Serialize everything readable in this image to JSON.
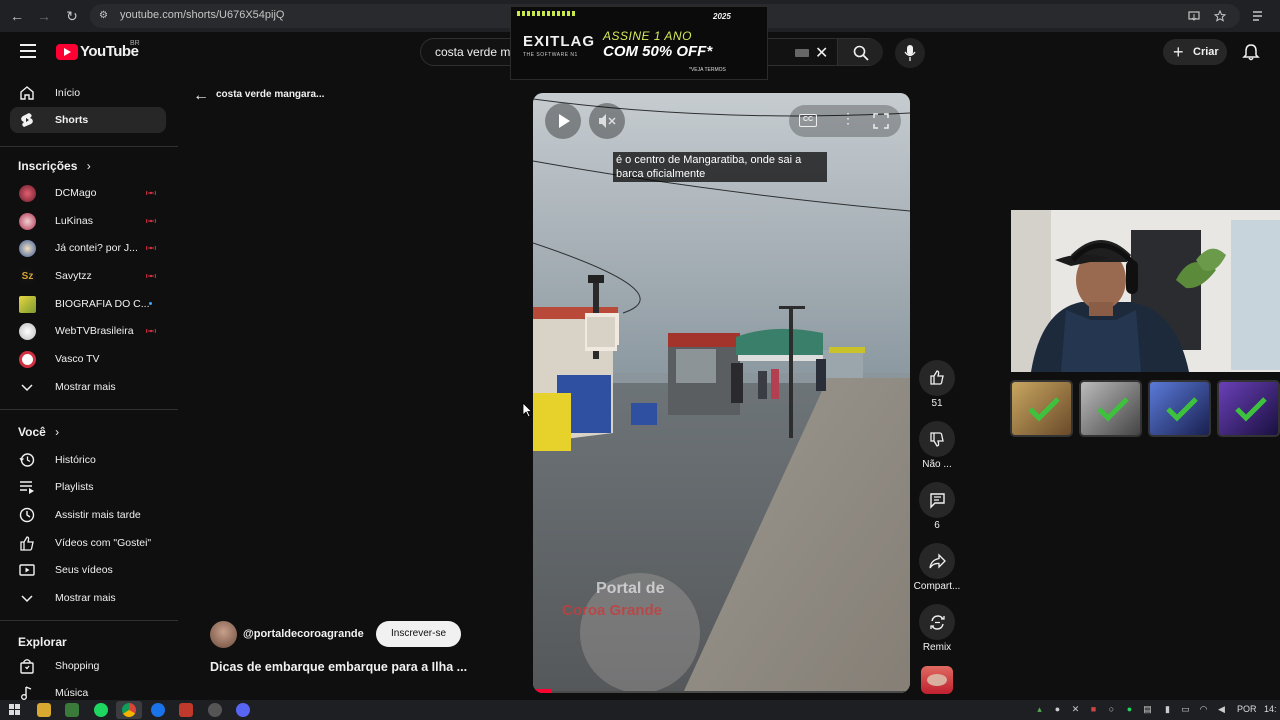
{
  "browser": {
    "url": "youtube.com/shorts/U676X54pijQ",
    "nav_back": "←",
    "nav_forward": "→",
    "reload": "↻"
  },
  "header": {
    "logo_text": "YouTube",
    "region": "BR",
    "search_query": "costa verde m",
    "create_label": "Criar",
    "create_plus": "+"
  },
  "ad": {
    "brand": "EXITLAG",
    "brand_sub": "THE SOFTWARE N1",
    "line1": "ASSINE 1 ANO",
    "line2": "COM 50% OFF*",
    "note": "*VEJA TERMOS",
    "badge": "2025"
  },
  "sidebar": {
    "main": [
      {
        "label": "Início",
        "icon": "home-icon"
      },
      {
        "label": "Shorts",
        "icon": "shorts-icon"
      }
    ],
    "subscriptions_title": "Inscrições",
    "subscriptions": [
      {
        "label": "DCMago",
        "color": "#b0303a",
        "live": true
      },
      {
        "label": "LuKinas",
        "color": "#c04050",
        "live": true
      },
      {
        "label": "Já contei? por J...",
        "color": "#4a6fb5",
        "live": true
      },
      {
        "label": "Savytzz",
        "color": "#c9a227",
        "live": true
      },
      {
        "label": "BIOGRAFIA DO C...",
        "color": "#e0d040",
        "live": false
      },
      {
        "label": "WebTVBrasileira",
        "color": "#dddddd",
        "live": true
      },
      {
        "label": "Vasco TV",
        "color": "#d03040",
        "live": false
      }
    ],
    "show_more_1": "Mostrar mais",
    "you_title": "Você",
    "you_items": [
      {
        "label": "Histórico",
        "icon": "history-icon"
      },
      {
        "label": "Playlists",
        "icon": "playlists-icon"
      },
      {
        "label": "Assistir mais tarde",
        "icon": "watch-later-icon"
      },
      {
        "label": "Vídeos com \"Gostei\"",
        "icon": "liked-icon"
      },
      {
        "label": "Seus vídeos",
        "icon": "your-videos-icon"
      }
    ],
    "show_more_2": "Mostrar mais",
    "explore_title": "Explorar",
    "explore_items": [
      {
        "label": "Shopping",
        "icon": "shopping-icon"
      },
      {
        "label": "Música",
        "icon": "music-icon"
      }
    ]
  },
  "shorts": {
    "back_title": "costa verde mangara...",
    "caption": "é o centro de Mangaratiba, onde sai a barca oficialmente",
    "watermark_line1": "Portal de",
    "watermark_line2": "Coroa Grande",
    "channel": "@portaldecoroagrande",
    "subscribe_label": "Inscrever-se",
    "video_title": "Dicas de embarque embarque para a Ilha ...",
    "cc_label": "CC",
    "progress": 0.05
  },
  "actions": {
    "likes": "51",
    "dislike_label": "Não ...",
    "comments": "6",
    "share_label": "Compart...",
    "remix_label": "Remix"
  },
  "taskbar": {
    "lang": "POR",
    "time": "14:"
  }
}
